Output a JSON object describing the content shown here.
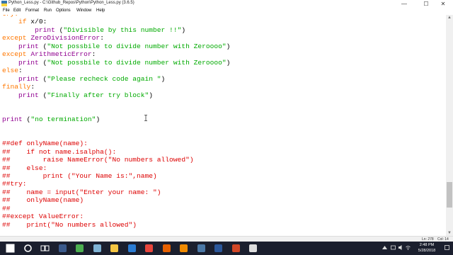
{
  "window": {
    "title": "Python_Less.py - C:\\Github_Repos\\Python\\Python_Less.py (3.6.5)",
    "minimize_glyph": "—",
    "maximize_glyph": "☐",
    "close_glyph": "✕"
  },
  "menu": [
    "File",
    "Edit",
    "Format",
    "Run",
    "Options",
    "Window",
    "Help"
  ],
  "code": [
    [
      [
        "kw",
        "try:"
      ]
    ],
    [
      [
        "",
        "    "
      ],
      [
        "kw",
        "if"
      ],
      [
        "",
        " x/0:"
      ]
    ],
    [
      [
        "",
        "        "
      ],
      [
        "bi",
        "print"
      ],
      [
        "",
        " ("
      ],
      [
        "st",
        "\"Divisible by this number !!\""
      ],
      [
        "",
        ")"
      ]
    ],
    [
      [
        "kw",
        "except"
      ],
      [
        "",
        " "
      ],
      [
        "bi",
        "ZeroDivisionError"
      ],
      [
        "",
        ":"
      ]
    ],
    [
      [
        "",
        "    "
      ],
      [
        "bi",
        "print"
      ],
      [
        "",
        " ("
      ],
      [
        "st",
        "\"Not possbile to divide number with Zeroooo\""
      ],
      [
        "",
        ")"
      ]
    ],
    [
      [
        "kw",
        "except"
      ],
      [
        "",
        " "
      ],
      [
        "bi",
        "ArithmeticError"
      ],
      [
        "",
        ":"
      ]
    ],
    [
      [
        "",
        "    "
      ],
      [
        "bi",
        "print"
      ],
      [
        "",
        " ("
      ],
      [
        "st",
        "\"Not possbile to divide number with Zeroooo\""
      ],
      [
        "",
        ")"
      ]
    ],
    [
      [
        "kw",
        "else"
      ],
      [
        "",
        ":"
      ]
    ],
    [
      [
        "",
        "    "
      ],
      [
        "bi",
        "print"
      ],
      [
        "",
        " ("
      ],
      [
        "st",
        "\"Please recheck code again \""
      ],
      [
        "",
        ")"
      ]
    ],
    [
      [
        "kw",
        "finally"
      ],
      [
        "",
        ":"
      ]
    ],
    [
      [
        "",
        "    "
      ],
      [
        "bi",
        "print"
      ],
      [
        "",
        " ("
      ],
      [
        "st",
        "\"Finally after try block\""
      ],
      [
        "",
        ")"
      ]
    ],
    [],
    [],
    [
      [
        "bi",
        "print"
      ],
      [
        "",
        " ("
      ],
      [
        "st",
        "\"no termination\""
      ],
      [
        "",
        ")"
      ]
    ],
    [],
    [],
    [
      [
        "cm",
        "##def onlyName(name):"
      ]
    ],
    [
      [
        "cm",
        "##    if not name.isalpha():"
      ]
    ],
    [
      [
        "cm",
        "##        raise NameError(\"No numbers allowed\")"
      ]
    ],
    [
      [
        "cm",
        "##    else:"
      ]
    ],
    [
      [
        "cm",
        "##        print (\"Your Name is:\",name)"
      ]
    ],
    [
      [
        "cm",
        "##try:"
      ]
    ],
    [
      [
        "cm",
        "##    name = input(\"Enter your name: \")"
      ]
    ],
    [
      [
        "cm",
        "##    onlyName(name)"
      ]
    ],
    [
      [
        "cm",
        "##"
      ]
    ],
    [
      [
        "cm",
        "##except ValueError:"
      ]
    ],
    [
      [
        "cm",
        "##    print(\"No numbers allowed\")"
      ]
    ]
  ],
  "status": {
    "line": "Ln: 278",
    "col": "Col: 14"
  },
  "taskbar": {
    "time": "2:48 PM",
    "date": "5/28/2018",
    "icons": [
      {
        "name": "start-icon",
        "color": "#ffffff"
      },
      {
        "name": "cortana-icon",
        "color": "#ffffff"
      },
      {
        "name": "task-view-icon",
        "color": "#ffffff"
      },
      {
        "name": "steam-icon",
        "color": "#3b5a8c"
      },
      {
        "name": "chrome-icon",
        "color": "#4caf50"
      },
      {
        "name": "notepad-icon",
        "color": "#7fb3d5"
      },
      {
        "name": "file-explorer-icon",
        "color": "#f4c542"
      },
      {
        "name": "edge-icon",
        "color": "#2b7cd3"
      },
      {
        "name": "chrome-icon",
        "color": "#e8453c"
      },
      {
        "name": "firefox-icon",
        "color": "#e66000"
      },
      {
        "name": "vlc-icon",
        "color": "#f08a00"
      },
      {
        "name": "python-idle-icon",
        "color": "#4b78a6"
      },
      {
        "name": "word-icon",
        "color": "#2b579a"
      },
      {
        "name": "powerpoint-icon",
        "color": "#d24726"
      },
      {
        "name": "photos-icon",
        "color": "#dddddd"
      }
    ]
  }
}
